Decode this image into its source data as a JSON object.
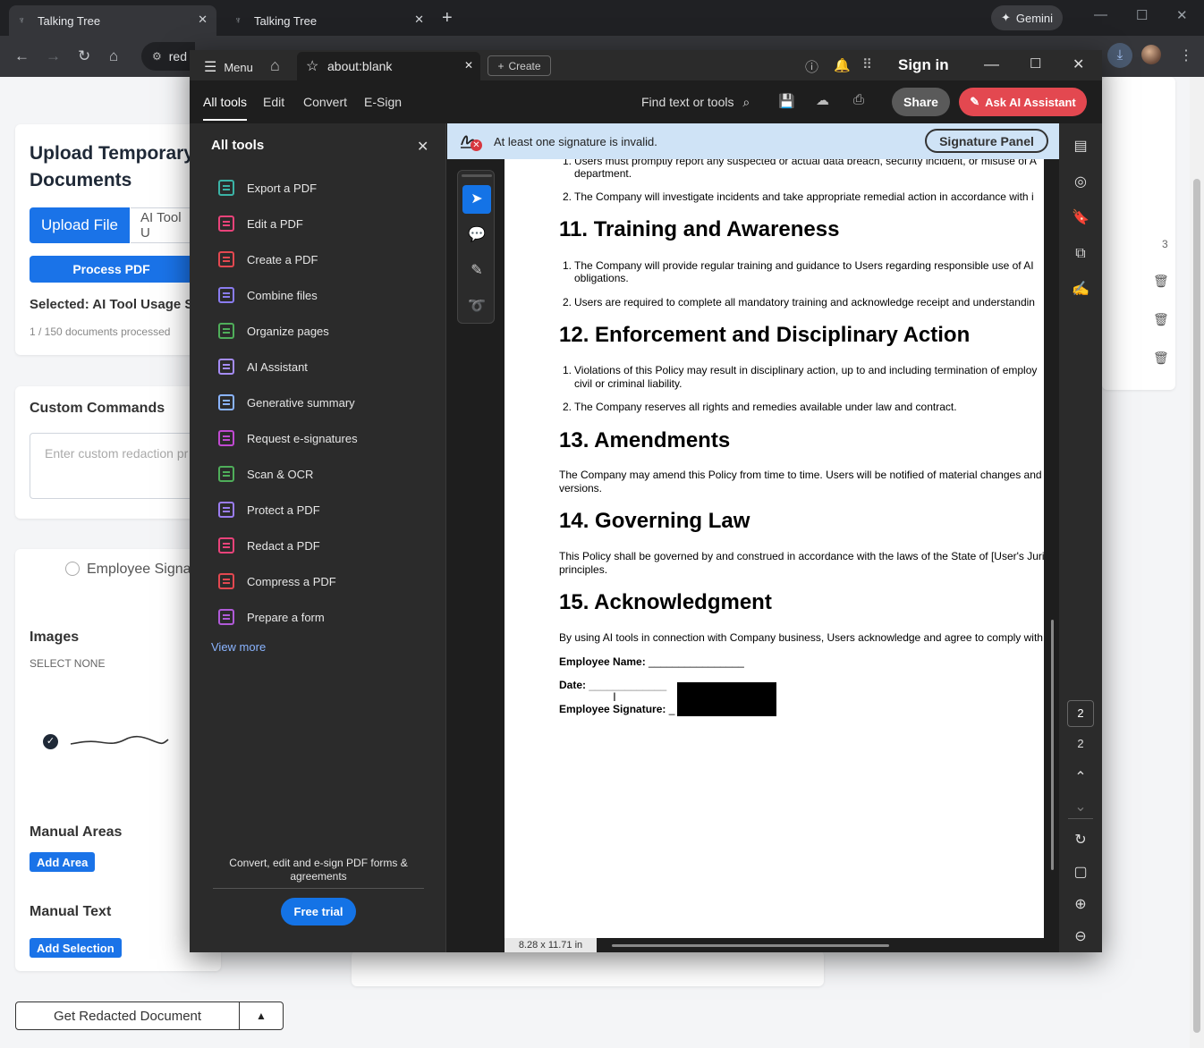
{
  "browser": {
    "tabs": [
      {
        "title": "Talking Tree",
        "active": true
      },
      {
        "title": "Talking Tree",
        "active": false
      }
    ],
    "gemini_label": "Gemini",
    "omnibox_text": "red"
  },
  "app": {
    "upload_title_line1": "Upload Temporary",
    "upload_title_line2": "Documents",
    "upload_file_label": "Upload File",
    "ai_tool_tab_label": "AI Tool U",
    "process_label": "Process PDF",
    "selected_text": "Selected: AI Tool Usage Sign",
    "count_text": "1 / 150 documents processed",
    "custom_commands_heading": "Custom Commands",
    "custom_placeholder": "Enter custom redaction pr",
    "radio_label": "Employee Signat",
    "images_heading": "Images",
    "select_none": "SELECT NONE",
    "manual_areas_heading": "Manual Areas",
    "add_area_label": "Add Area",
    "manual_text_heading": "Manual Text",
    "add_selection_label": "Add Selection",
    "get_redacted_label": "Get Redacted Document",
    "side_count": "3"
  },
  "acrobat": {
    "menu_label": "Menu",
    "tab_title": "about:blank",
    "create_label": "Create",
    "sign_in": "Sign in",
    "main_tabs": [
      "All tools",
      "Edit",
      "Convert",
      "E-Sign"
    ],
    "find_label": "Find text or tools",
    "share_label": "Share",
    "ai_assistant_label": "Ask AI Assistant",
    "tools_heading": "All tools",
    "tools": [
      {
        "label": "Export a PDF",
        "color": "#3bb3a6"
      },
      {
        "label": "Edit a PDF",
        "color": "#e9437a"
      },
      {
        "label": "Create a PDF",
        "color": "#e34850"
      },
      {
        "label": "Combine files",
        "color": "#8a7cf0"
      },
      {
        "label": "Organize pages",
        "color": "#4fae5a"
      },
      {
        "label": "AI Assistant",
        "color": "#a58cf5"
      },
      {
        "label": "Generative summary",
        "color": "#8ab4ff"
      },
      {
        "label": "Request e-signatures",
        "color": "#c04ad1"
      },
      {
        "label": "Scan & OCR",
        "color": "#4fae5a"
      },
      {
        "label": "Protect a PDF",
        "color": "#9a7cf0"
      },
      {
        "label": "Redact a PDF",
        "color": "#e9437a"
      },
      {
        "label": "Compress a PDF",
        "color": "#e34850"
      },
      {
        "label": "Prepare a form",
        "color": "#b05ad8"
      }
    ],
    "view_more": "View more",
    "promo_text": "Convert, edit and e-sign PDF forms & agreements",
    "free_trial_label": "Free trial",
    "signature_warning": "At least one signature is invalid.",
    "signature_panel_label": "Signature Panel",
    "page_size": "8.28 x 11.71 in",
    "current_page": "2",
    "total_pages": "2"
  },
  "document": {
    "top_item1_line1": "Users must promptly report any suspected or actual data breach, security incident, or misuse of A",
    "top_item1_line2": "department.",
    "top_item2": "The Company will investigate incidents and take appropriate remedial action in accordance with i",
    "s11_heading": "11. Training and Awareness",
    "s11_item1_line1": "The Company will provide regular training and guidance to Users regarding responsible use of AI",
    "s11_item1_line2": "obligations.",
    "s11_item2": "Users are required to complete all mandatory training and acknowledge receipt and understandin",
    "s12_heading": "12. Enforcement and Disciplinary Action",
    "s12_item1_line1": "Violations of this Policy may result in disciplinary action, up to and including termination of employ",
    "s12_item1_line2": "civil or criminal liability.",
    "s12_item2": "The Company reserves all rights and remedies available under law and contract.",
    "s13_heading": "13. Amendments",
    "s13_text_line1": "The Company may amend this Policy from time to time. Users will be notified of material changes and r",
    "s13_text_line2": "versions.",
    "s14_heading": "14. Governing Law",
    "s14_text_line1": "This Policy shall be governed by and construed in accordance with the laws of the State of [User's Juris",
    "s14_text_line2": "principles.",
    "s15_heading": "15. Acknowledgment",
    "s15_text": "By using AI tools in connection with Company business, Users acknowledge and agree to comply with t",
    "employee_name_label": "Employee Name:",
    "employee_name_line": "________________",
    "date_label": "Date:",
    "date_line": "_____________",
    "employee_signature_label": "Employee Signature:"
  },
  "colors": {
    "primary_blue": "#1a73e8",
    "acrobat_red": "#e34850",
    "banner_blue": "#cfe3f6"
  }
}
